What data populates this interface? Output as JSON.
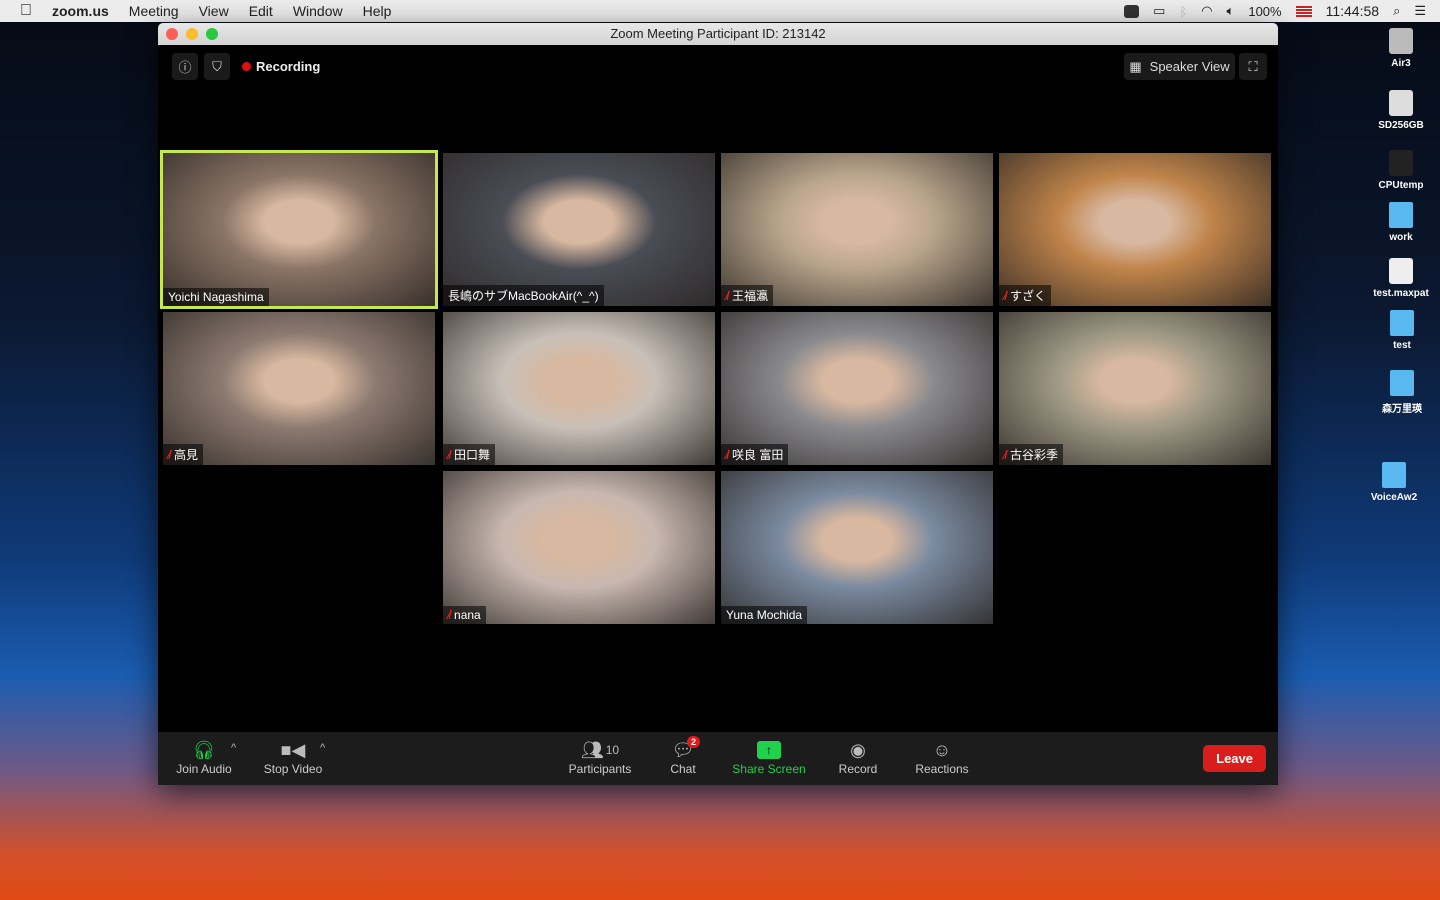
{
  "menubar": {
    "app": "zoom.us",
    "items": [
      "Meeting",
      "View",
      "Edit",
      "Window",
      "Help"
    ],
    "battery": "100%",
    "clock": "11:44:58"
  },
  "window": {
    "title": "Zoom Meeting Participant ID: 213142",
    "recording": "Recording",
    "speaker_view": "Speaker View"
  },
  "tiles": [
    {
      "name": "Yoichi Nagashima",
      "muted": false,
      "active": true,
      "bg": "#8a7466"
    },
    {
      "name": "長嶋のサブMacBookAir(^_^)",
      "muted": false,
      "active": false,
      "bg": "#4a4d55"
    },
    {
      "name": "王福瀛",
      "muted": true,
      "active": false,
      "bg": "#b9a58c"
    },
    {
      "name": "すざく",
      "muted": true,
      "active": false,
      "bg": "#c0844a"
    },
    {
      "name": "高見",
      "muted": true,
      "active": false,
      "bg": "#8c7a70"
    },
    {
      "name": "田口舞",
      "muted": true,
      "active": false,
      "bg": "#c8c0b8"
    },
    {
      "name": "咲良 富田",
      "muted": true,
      "active": false,
      "bg": "#8a8a8e"
    },
    {
      "name": "古谷彩季",
      "muted": true,
      "active": false,
      "bg": "#a09a86"
    },
    {
      "name": "nana",
      "muted": true,
      "active": false,
      "bg": "#c8b8b0"
    },
    {
      "name": "Yuna Mochida",
      "muted": false,
      "active": false,
      "bg": "#7a8aa0"
    }
  ],
  "toolbar": {
    "join_audio": "Join Audio",
    "stop_video": "Stop Video",
    "participants": "Participants",
    "participants_count": "10",
    "chat": "Chat",
    "chat_badge": "2",
    "share_screen": "Share Screen",
    "record": "Record",
    "reactions": "Reactions",
    "leave": "Leave"
  },
  "desktop": [
    "Air3",
    "SD256GB",
    "CPUtemp",
    "work",
    "test.maxpat",
    "test",
    "森万里瑛",
    "VoiceAw2"
  ]
}
